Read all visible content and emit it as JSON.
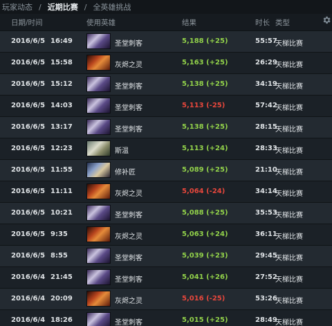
{
  "tabs": [
    "玩家动态",
    "近期比赛",
    "全英雄挑战"
  ],
  "tab_separator": "/",
  "active_tab_index": 1,
  "columns": {
    "datetime": "日期/时间",
    "hero": "使用英雄",
    "result": "结果",
    "duration": "时长",
    "type": "类型"
  },
  "settings_icon": "gear-icon",
  "colors": {
    "win": "#92d24a",
    "loss": "#e8473c"
  },
  "matches": [
    {
      "date": "2016/6/5",
      "time": "16:49",
      "hero": "圣堂刺客",
      "hero_icon": "templar-assassin",
      "result": "5,188 (+25)",
      "win": true,
      "duration": "55:57",
      "type": "天梯比赛"
    },
    {
      "date": "2016/6/5",
      "time": "15:58",
      "hero": "灰烬之灵",
      "hero_icon": "ember-spirit",
      "result": "5,163 (+25)",
      "win": true,
      "duration": "26:29",
      "type": "天梯比赛"
    },
    {
      "date": "2016/6/5",
      "time": "15:12",
      "hero": "圣堂刺客",
      "hero_icon": "templar-assassin",
      "result": "5,138 (+25)",
      "win": true,
      "duration": "34:19",
      "type": "天梯比赛"
    },
    {
      "date": "2016/6/5",
      "time": "14:03",
      "hero": "圣堂刺客",
      "hero_icon": "templar-assassin",
      "result": "5,113 (-25)",
      "win": false,
      "duration": "57:42",
      "type": "天梯比赛"
    },
    {
      "date": "2016/6/5",
      "time": "13:17",
      "hero": "圣堂刺客",
      "hero_icon": "templar-assassin",
      "result": "5,138 (+25)",
      "win": true,
      "duration": "28:15",
      "type": "天梯比赛"
    },
    {
      "date": "2016/6/5",
      "time": "12:23",
      "hero": "斯温",
      "hero_icon": "sven",
      "result": "5,113 (+24)",
      "win": true,
      "duration": "28:33",
      "type": "天梯比赛"
    },
    {
      "date": "2016/6/5",
      "time": "11:55",
      "hero": "修补匠",
      "hero_icon": "tinker",
      "result": "5,089 (+25)",
      "win": true,
      "duration": "21:10",
      "type": "天梯比赛"
    },
    {
      "date": "2016/6/5",
      "time": "11:11",
      "hero": "灰烬之灵",
      "hero_icon": "ember-spirit",
      "result": "5,064 (-24)",
      "win": false,
      "duration": "34:14",
      "type": "天梯比赛"
    },
    {
      "date": "2016/6/5",
      "time": "10:21",
      "hero": "圣堂刺客",
      "hero_icon": "templar-assassin",
      "result": "5,088 (+25)",
      "win": true,
      "duration": "35:53",
      "type": "天梯比赛"
    },
    {
      "date": "2016/6/5",
      "time": "9:35",
      "hero": "灰烬之灵",
      "hero_icon": "ember-spirit",
      "result": "5,063 (+24)",
      "win": true,
      "duration": "36:11",
      "type": "天梯比赛"
    },
    {
      "date": "2016/6/5",
      "time": "8:55",
      "hero": "圣堂刺客",
      "hero_icon": "templar-assassin",
      "result": "5,039 (+23)",
      "win": true,
      "duration": "29:45",
      "type": "天梯比赛"
    },
    {
      "date": "2016/6/4",
      "time": "21:45",
      "hero": "圣堂刺客",
      "hero_icon": "templar-assassin",
      "result": "5,041 (+26)",
      "win": true,
      "duration": "27:52",
      "type": "天梯比赛"
    },
    {
      "date": "2016/6/4",
      "time": "20:09",
      "hero": "灰烬之灵",
      "hero_icon": "ember-spirit",
      "result": "5,016 (-25)",
      "win": false,
      "duration": "53:26",
      "type": "天梯比赛"
    },
    {
      "date": "2016/6/4",
      "time": "18:26",
      "hero": "圣堂刺客",
      "hero_icon": "templar-assassin",
      "result": "5,015 (+25)",
      "win": true,
      "duration": "28:49",
      "type": "天梯比赛"
    }
  ]
}
